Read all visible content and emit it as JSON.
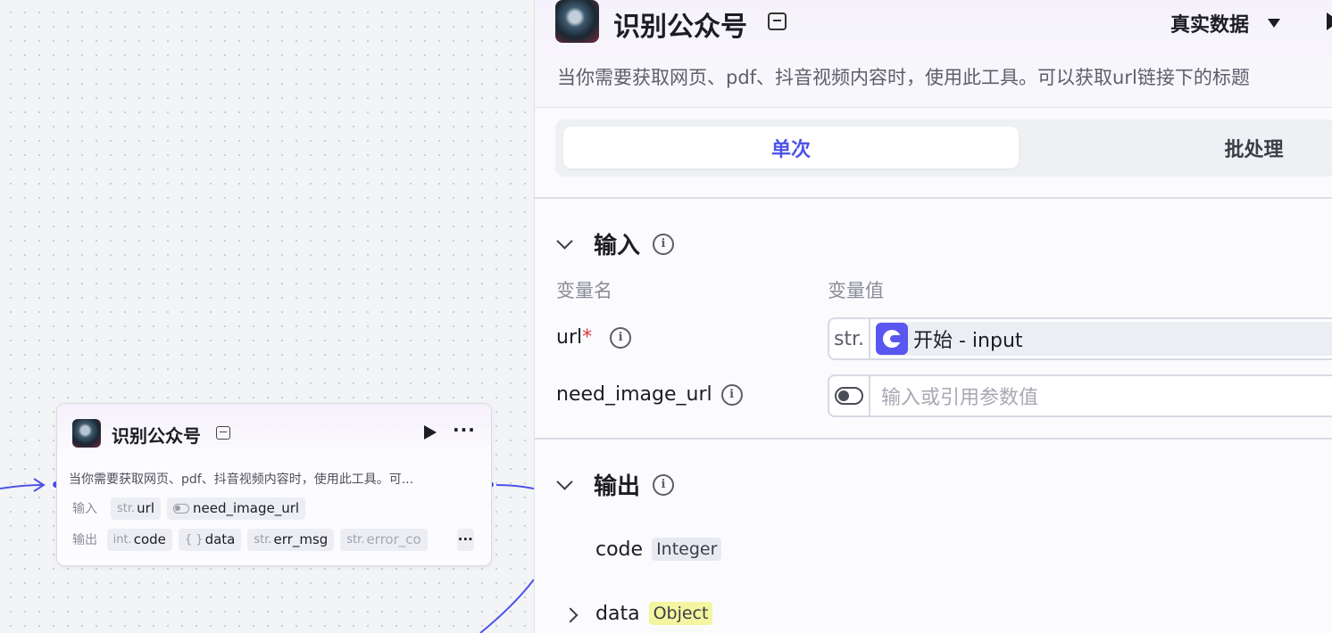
{
  "canvas": {
    "node": {
      "title": "识别公众号",
      "description": "当你需要获取网页、pdf、抖音视频内容时，使用此工具。可...",
      "input_label": "输入",
      "output_label": "输出",
      "inputs": [
        {
          "type": "str.",
          "name": "url"
        },
        {
          "type": "toggle",
          "name": "need_image_url"
        }
      ],
      "outputs": [
        {
          "type": "int.",
          "name": "code"
        },
        {
          "type": "{ }",
          "name": "data"
        },
        {
          "type": "str.",
          "name": "err_msg"
        },
        {
          "type": "str.",
          "name": "error_co"
        }
      ],
      "more_label": "···"
    }
  },
  "panel": {
    "title": "识别公众号",
    "mode": "真实数据",
    "description": "当你需要获取网页、pdf、抖音视频内容时，使用此工具。可以获取url链接下的标题",
    "tabs": [
      {
        "label": "单次",
        "active": true
      },
      {
        "label": "批处理",
        "active": false
      }
    ],
    "input_section": {
      "title": "输入",
      "col_name": "变量名",
      "col_value": "变量值",
      "params": [
        {
          "name": "url",
          "required_mark": "*",
          "type": "str.",
          "reference": "开始 - input"
        },
        {
          "name": "need_image_url",
          "type": "toggle",
          "placeholder": "输入或引用参数值"
        }
      ]
    },
    "output_section": {
      "title": "输出",
      "fields": [
        {
          "name": "code",
          "type": "Integer"
        },
        {
          "name": "data",
          "type": "Object"
        }
      ]
    }
  },
  "colors": {
    "accent": "#4d53e8",
    "required": "#e0363d",
    "object_badge": "#f3f5a0"
  }
}
